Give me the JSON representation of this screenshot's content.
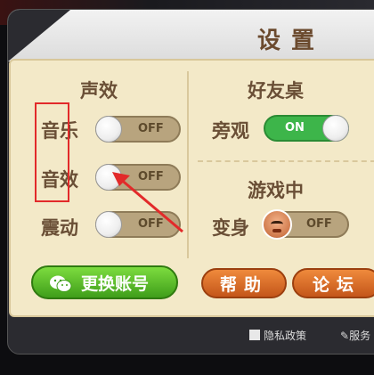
{
  "dialog": {
    "title": "设置"
  },
  "sound": {
    "section_title": "声效",
    "music": {
      "label": "音乐",
      "state": "OFF"
    },
    "effects": {
      "label": "音效",
      "state": "OFF"
    },
    "vibration": {
      "label": "震动",
      "state": "OFF"
    }
  },
  "friends_table": {
    "section_title": "好友桌",
    "spectate": {
      "label": "旁观",
      "state": "ON"
    }
  },
  "in_game": {
    "section_title": "游戏中",
    "transform": {
      "label": "变身",
      "state": "OFF"
    }
  },
  "buttons": {
    "switch_account": "更换账号",
    "help": "帮助",
    "forum": "论坛"
  },
  "footer": {
    "privacy": "隐私政策",
    "service": "服务"
  },
  "colors": {
    "annotation": "#e22a2a",
    "toggle_on": "#3db54a",
    "toggle_off": "#b8a47e"
  }
}
